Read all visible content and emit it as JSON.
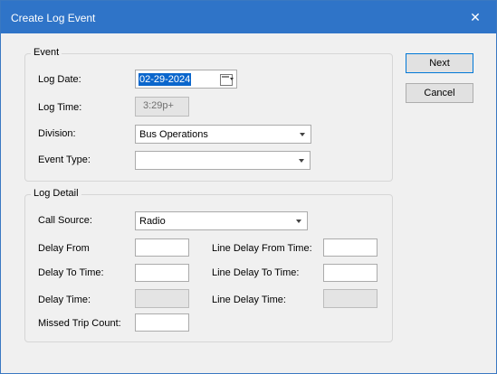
{
  "window": {
    "title": "Create Log Event",
    "close_glyph": "✕"
  },
  "event_group": {
    "title": "Event",
    "log_date_label": "Log Date:",
    "log_date_value": "02-29-2024",
    "log_time_label": "Log Time:",
    "log_time_value": "3:29p+",
    "division_label": "Division:",
    "division_value": "Bus Operations",
    "event_type_label": "Event Type:",
    "event_type_value": ""
  },
  "detail_group": {
    "title": "Log Detail",
    "call_source_label": "Call Source:",
    "call_source_value": "Radio",
    "delay_from_label": "Delay From",
    "delay_to_time_label": "Delay To Time:",
    "delay_time_label": "Delay Time:",
    "missed_trip_label": "Missed Trip Count:",
    "line_delay_from_label": "Line Delay From Time:",
    "line_delay_to_label": "Line Delay To Time:",
    "line_delay_time_label": "Line Delay Time:"
  },
  "buttons": {
    "next": "Next",
    "cancel": "Cancel"
  },
  "icons": {
    "calendar": "calendar-icon",
    "dropdown": "chevron-down-icon",
    "close": "close-icon"
  },
  "colors": {
    "titlebar": "#2f74c8",
    "selection": "#0a66cc"
  }
}
